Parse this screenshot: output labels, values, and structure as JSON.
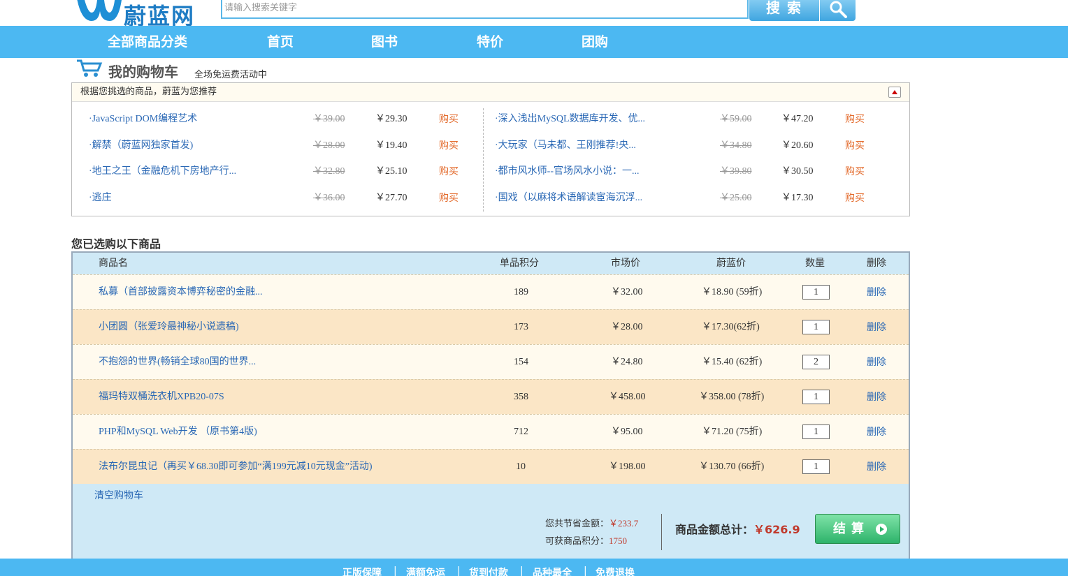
{
  "header": {
    "logo_text": "蔚蓝网",
    "search_placeholder": "请输入搜索关键字",
    "search_button": "搜索"
  },
  "nav": [
    "全部商品分类",
    "首页",
    "图书",
    "特价",
    "团购"
  ],
  "cart": {
    "title": "我的购物车",
    "subtitle": "全场免运费活动中"
  },
  "recommend": {
    "header": "根据您挑选的商品，蔚蓝为您推荐",
    "buy_label": "购买",
    "left": [
      {
        "name": "·JavaScript DOM编程艺术",
        "old": "￥39.00",
        "price": "￥29.30"
      },
      {
        "name": "·解禁（蔚蓝网独家首发)",
        "old": "￥28.00",
        "price": "￥19.40"
      },
      {
        "name": "·地王之王（金融危机下房地产行...",
        "old": "￥32.80",
        "price": "￥25.10"
      },
      {
        "name": "·逃庄",
        "old": "￥36.00",
        "price": "￥27.70"
      }
    ],
    "right": [
      {
        "name": "·深入浅出MySQL数据库开发、优...",
        "old": "￥59.00",
        "price": "￥47.20"
      },
      {
        "name": "·大玩家（马未都、王刚推荐!央...",
        "old": "￥34.80",
        "price": "￥20.60"
      },
      {
        "name": "·都市风水师--官场风水小说：一...",
        "old": "￥39.80",
        "price": "￥30.50"
      },
      {
        "name": "·国戏（以麻将术语解读宦海沉浮...",
        "old": "￥25.00",
        "price": "￥17.30"
      }
    ]
  },
  "selected": {
    "title": "您已选购以下商品",
    "columns": [
      "商品名",
      "单品积分",
      "市场价",
      "蔚蓝价",
      "数量",
      "删除"
    ],
    "delete_label": "删除",
    "rows": [
      {
        "name": "私募（首部披露资本博弈秘密的金融...",
        "points": "189",
        "market": "￥32.00",
        "price": "￥18.90 (59折)",
        "qty": "1"
      },
      {
        "name": "小团圆（张爱玲最神秘小说遗稿)",
        "points": "173",
        "market": "￥28.00",
        "price": "￥17.30(62折)",
        "qty": "1"
      },
      {
        "name": "不抱怨的世界(畅销全球80国的世界...",
        "points": "154",
        "market": "￥24.80",
        "price": "￥15.40 (62折)",
        "qty": "2"
      },
      {
        "name": "福玛特双桶洗衣机XPB20-07S",
        "points": "358",
        "market": "￥458.00",
        "price": "￥358.00 (78折)",
        "qty": "1"
      },
      {
        "name": "PHP和MySQL Web开发 （原书第4版)",
        "points": "712",
        "market": "￥95.00",
        "price": "￥71.20 (75折)",
        "qty": "1"
      },
      {
        "name": "法布尔昆虫记（再买￥68.30即可参加“满199元减10元现金”活动)",
        "points": "10",
        "market": "￥198.00",
        "price": "￥130.70 (66折)",
        "qty": "1"
      }
    ],
    "clear_label": "清空购物车",
    "save_label": "您共节省金额：",
    "save_value": "￥233.7",
    "points_label": "可获商品积分：",
    "points_value": "1750",
    "total_label": "商品金额总计：",
    "total_value": "￥626.9",
    "checkout_label": "结算"
  },
  "footer": [
    "正版保障",
    "满额免运",
    "货到付款",
    "品种最全",
    "免费退换"
  ]
}
